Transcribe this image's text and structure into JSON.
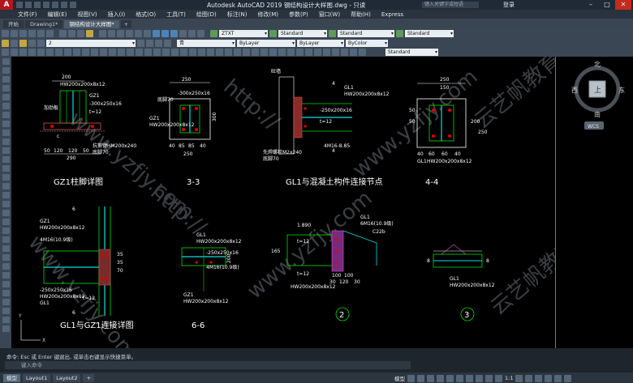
{
  "app": {
    "logo": "A",
    "title": "Autodesk AutoCAD 2019    钢结构设计大样图.dwg - 只读",
    "search_placeholder": "键入关键字或短语",
    "login": "登录"
  },
  "menu": [
    "文件(F)",
    "编辑(E)",
    "视图(V)",
    "插入(I)",
    "格式(O)",
    "工具(T)",
    "绘图(D)",
    "标注(N)",
    "修改(M)",
    "参数(P)",
    "窗口(W)",
    "帮助(H)",
    "Express"
  ],
  "tabs": [
    {
      "label": "开始"
    },
    {
      "label": "Drawing1*"
    },
    {
      "label": "钢结构设计大样图*"
    },
    {
      "label": "+"
    }
  ],
  "toolbar": {
    "layer_value": "2",
    "color_value": "青",
    "linetype_value": "ByLayer",
    "lineweight_value": "ByLayer",
    "plotstyle_value": "ByColor",
    "textstyle_value": "ZTXT",
    "dimstyle_value": "Standard",
    "tablestyle_value": "Standard",
    "mleaderstyle_value": "Standard",
    "style_value_row3": "Standard"
  },
  "viewcube": {
    "north": "北",
    "south": "南",
    "east": "东",
    "west": "西",
    "top": "上",
    "wcs": "WCS"
  },
  "command": {
    "history": "命令: Esc 或 Enter 键退出, 或单击右键显示快捷菜单。",
    "placeholder": "键入命令"
  },
  "status": {
    "layouts": [
      "模型",
      "Layout1",
      "Layout2",
      "+"
    ],
    "model": "模型",
    "scale": "1:1"
  },
  "drawing": {
    "watermark": "www.yzfjy.com",
    "watermark2": "http://",
    "watermark3": "云艺帆教育",
    "d1": {
      "title": "GZ1柱脚详图",
      "labels": [
        "200",
        "HW200x200x8x12",
        "GZ1",
        "-300x250x16",
        "t=12",
        "加劲板",
        "c",
        "M24",
        "50",
        "120",
        "120",
        "50",
        "290",
        "先焊螺栓",
        "抗剪键HM200x240",
        "底脚70"
      ]
    },
    "d2": {
      "title": "3-3",
      "labels": [
        "250",
        "-300x250x16",
        "GZ1",
        "HW200x200x8x12",
        "底脚70",
        "40",
        "85",
        "85",
        "40",
        "250",
        "300",
        "3",
        "3"
      ]
    },
    "d3": {
      "title": "GL1与混凝土构件连接节点",
      "labels": [
        "砼墙",
        "GL1",
        "HW200x200x8x12",
        "-250x200x16",
        "t=12",
        "4M16-8.85",
        "先焊螺栓M2x240",
        "底脚70",
        "4",
        "4"
      ]
    },
    "d4": {
      "title": "4-4",
      "labels": [
        "250",
        "150",
        "50",
        "50",
        "40",
        "60",
        "60",
        "40",
        "200",
        "250",
        "70",
        "70",
        "20",
        "HW200x200x8x12",
        "GL1"
      ]
    },
    "d5": {
      "title": "GL1与GZ1连接详图",
      "labels": [
        "6",
        "GZ1",
        "HW200x200x8x12",
        "4M16(10.9级)",
        "8",
        "-250x250x16",
        "HW200x200x8x12",
        "GL1",
        "t=12",
        "6",
        "35",
        "35",
        "70"
      ]
    },
    "d6": {
      "title": "6-6",
      "labels": [
        "GL1",
        "HW200x200x8x12",
        "-250x250x16",
        "4M16(10.9级)",
        "45",
        "80",
        "45",
        "25",
        "200",
        "200",
        "GZ1",
        "HW200x200x8x12"
      ]
    },
    "d7": {
      "title": "2",
      "labels": [
        "GL1",
        "6M16(10.9级)",
        "t=12",
        "1.890",
        "C22b",
        "100",
        "100",
        "105",
        "30",
        "120",
        "30",
        "HW200x200x8x12",
        "165",
        "t=12"
      ]
    },
    "d8": {
      "title": "3",
      "labels": [
        "8",
        "8",
        "GL1",
        "HW200x200x8x12"
      ]
    }
  }
}
